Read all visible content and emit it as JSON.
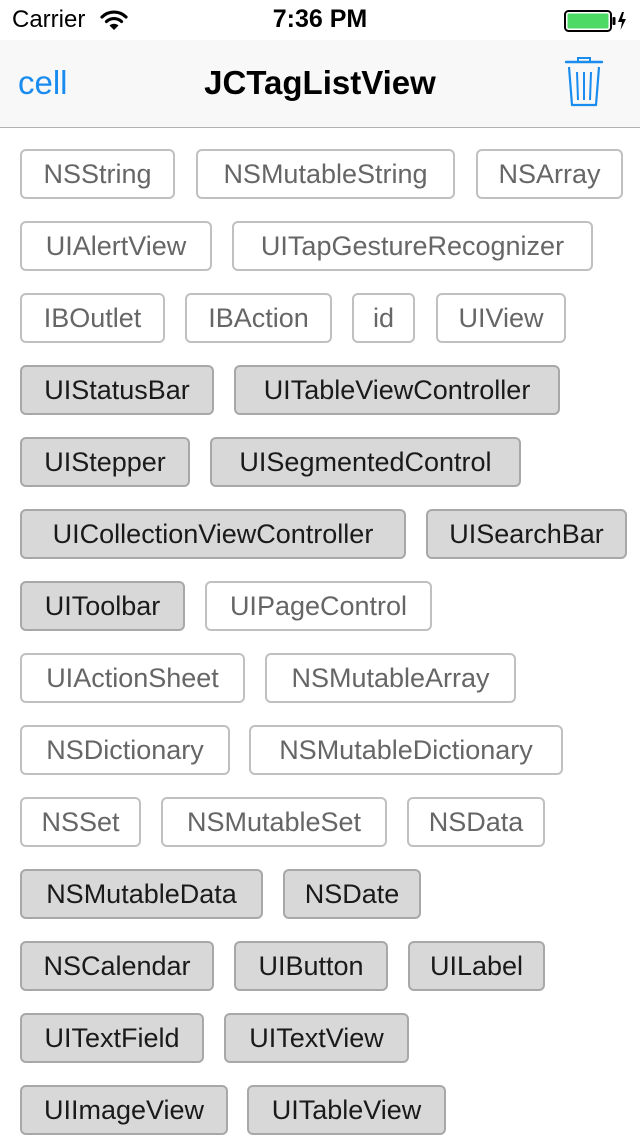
{
  "status": {
    "carrier": "Carrier",
    "time": "7:36 PM"
  },
  "nav": {
    "left": "cell",
    "title": "JCTagListView",
    "right_icon": "trash-icon"
  },
  "colors": {
    "accent": "#1a8cf0",
    "battery": "#4cd964",
    "tag_selected_bg": "#d8d8d8"
  },
  "tags": [
    {
      "label": "NSString",
      "selected": false
    },
    {
      "label": "NSMutableString",
      "selected": false
    },
    {
      "label": "NSArray",
      "selected": false
    },
    {
      "label": "UIAlertView",
      "selected": false
    },
    {
      "label": "UITapGestureRecognizer",
      "selected": false
    },
    {
      "label": "IBOutlet",
      "selected": false
    },
    {
      "label": "IBAction",
      "selected": false
    },
    {
      "label": "id",
      "selected": false
    },
    {
      "label": "UIView",
      "selected": false
    },
    {
      "label": "UIStatusBar",
      "selected": true
    },
    {
      "label": "UITableViewController",
      "selected": true
    },
    {
      "label": "UIStepper",
      "selected": true
    },
    {
      "label": "UISegmentedControl",
      "selected": true
    },
    {
      "label": "UICollectionViewController",
      "selected": true
    },
    {
      "label": "UISearchBar",
      "selected": true
    },
    {
      "label": "UIToolbar",
      "selected": true
    },
    {
      "label": "UIPageControl",
      "selected": false
    },
    {
      "label": "UIActionSheet",
      "selected": false
    },
    {
      "label": "NSMutableArray",
      "selected": false
    },
    {
      "label": "NSDictionary",
      "selected": false
    },
    {
      "label": "NSMutableDictionary",
      "selected": false
    },
    {
      "label": "NSSet",
      "selected": false
    },
    {
      "label": "NSMutableSet",
      "selected": false
    },
    {
      "label": "NSData",
      "selected": false
    },
    {
      "label": "NSMutableData",
      "selected": true
    },
    {
      "label": "NSDate",
      "selected": true
    },
    {
      "label": "NSCalendar",
      "selected": true
    },
    {
      "label": "UIButton",
      "selected": true
    },
    {
      "label": "UILabel",
      "selected": true
    },
    {
      "label": "UITextField",
      "selected": true
    },
    {
      "label": "UITextView",
      "selected": true
    },
    {
      "label": "UIImageView",
      "selected": true
    },
    {
      "label": "UITableView",
      "selected": true
    }
  ]
}
